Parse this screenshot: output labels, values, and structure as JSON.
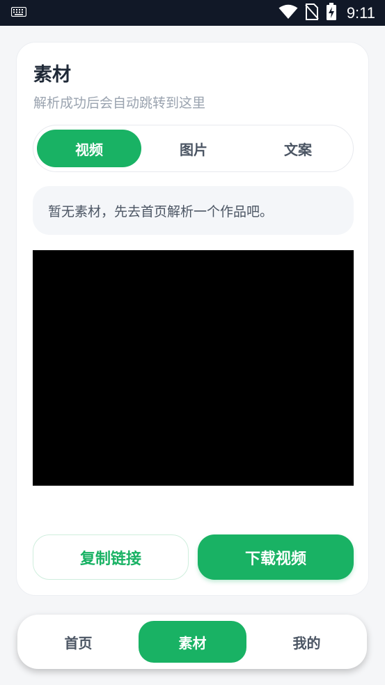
{
  "status_bar": {
    "time": "9:11",
    "icons": [
      "keyboard-icon",
      "wifi-icon",
      "no-sim-icon",
      "battery-charging-icon"
    ]
  },
  "material": {
    "title": "素材",
    "subtitle": "解析成功后会自动跳转到这里",
    "tabs": [
      {
        "label": "视频",
        "active": true
      },
      {
        "label": "图片",
        "active": false
      },
      {
        "label": "文案",
        "active": false
      }
    ],
    "empty_notice": "暂无素材，先去首页解析一个作品吧。",
    "actions": {
      "copy_link": "复制链接",
      "download_video": "下载视频"
    }
  },
  "bottom_nav": {
    "items": [
      {
        "label": "首页",
        "active": false
      },
      {
        "label": "素材",
        "active": true
      },
      {
        "label": "我的",
        "active": false
      }
    ]
  },
  "colors": {
    "accent": "#19b264",
    "status_bar_bg": "#111827",
    "page_bg": "#f5f6f8"
  }
}
